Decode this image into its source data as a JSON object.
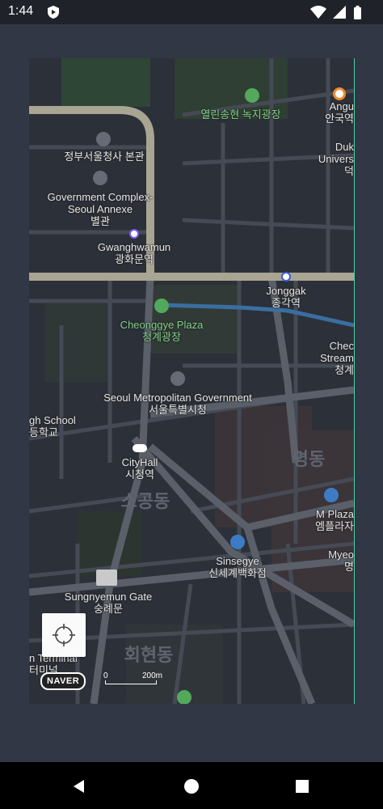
{
  "status_bar": {
    "time": "1:44"
  },
  "map": {
    "labels": [
      {
        "key": "park_top",
        "text": "열린송현 녹지광장",
        "style": "green"
      },
      {
        "key": "angukyeok",
        "text": "Angu\n안국역",
        "style": "normal"
      },
      {
        "key": "duksung",
        "text": "Duk\nUnivers\n덕",
        "style": "normal"
      },
      {
        "key": "gov_hq",
        "text": "정부서울청사 본관",
        "style": "normal"
      },
      {
        "key": "gov_annex",
        "text": "Government Complex-\nSeoul Annexe\n별관",
        "style": "normal"
      },
      {
        "key": "gwanghwamun",
        "text": "Gwanghwamun\n광화문역",
        "style": "normal"
      },
      {
        "key": "jonggak",
        "text": "Jonggak\n종각역",
        "style": "normal"
      },
      {
        "key": "cheonggye",
        "text": "Cheonggye Plaza\n청계광장",
        "style": "green"
      },
      {
        "key": "cheonggye_stream",
        "text": "Chec\nStream\n청계",
        "style": "normal"
      },
      {
        "key": "city_hall_gov",
        "text": "Seoul Metropolitan Government\n서울특별시청",
        "style": "normal"
      },
      {
        "key": "high_school",
        "text": "gh School\n등학교",
        "style": "normal"
      },
      {
        "key": "cityhall_station",
        "text": "CityHall\n시청역",
        "style": "normal"
      },
      {
        "key": "myeongdong",
        "text": "명동",
        "style": "district"
      },
      {
        "key": "sogongdong",
        "text": "소공동",
        "style": "district"
      },
      {
        "key": "m_plaza",
        "text": "M Plaza\n엠플라자",
        "style": "normal"
      },
      {
        "key": "myeo",
        "text": "Myeo\n명",
        "style": "normal"
      },
      {
        "key": "shinsegae",
        "text": "Sinsegye\n신세계백화점",
        "style": "normal"
      },
      {
        "key": "sungnyemun",
        "text": "Sungnyemun Gate\n숭례문",
        "style": "normal"
      },
      {
        "key": "hoehyeon",
        "text": "회현동",
        "style": "district"
      },
      {
        "key": "terminal",
        "text": "n Terminal\n터미널",
        "style": "normal"
      }
    ],
    "naver_logo": "NAVER",
    "scale": {
      "start": "0",
      "end": "200m"
    },
    "colors": {
      "green_label": "#7fcf8a",
      "accent_border": "#4fd1a5",
      "map_bg": "#2b2f38"
    }
  },
  "icons": [
    "shield-icon",
    "wifi-icon",
    "signal-icon",
    "battery-icon",
    "crosshair-icon",
    "park-icon",
    "building-icon",
    "subway-icon",
    "shopping-icon",
    "gate-icon",
    "back-icon",
    "home-icon",
    "recents-icon"
  ]
}
